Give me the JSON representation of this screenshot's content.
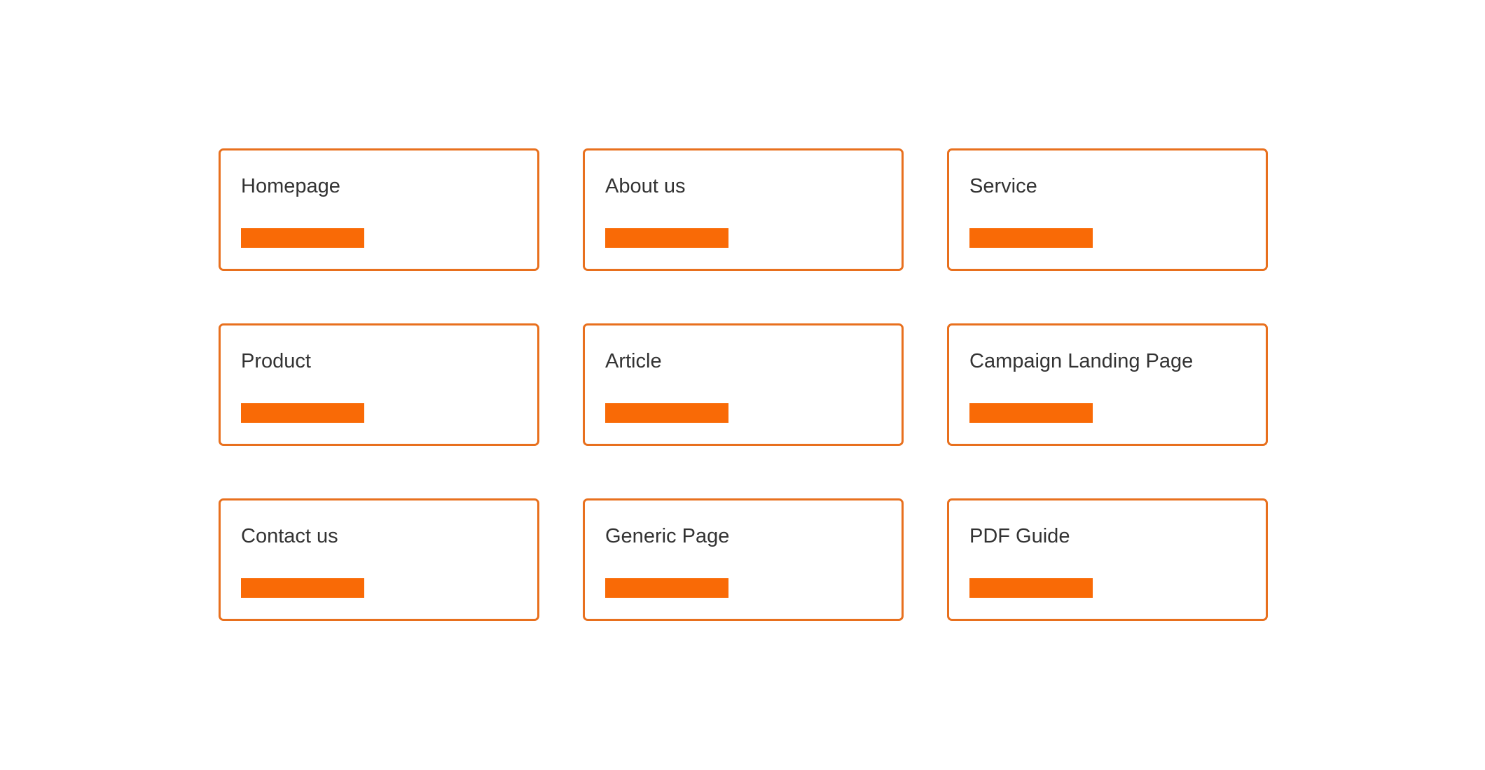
{
  "colors": {
    "card_border": "#E8701E",
    "accent_bar": "#F96A06",
    "text": "#333333",
    "background": "#FFFFFF"
  },
  "cards": [
    {
      "label": "Homepage"
    },
    {
      "label": "About us"
    },
    {
      "label": "Service"
    },
    {
      "label": "Product"
    },
    {
      "label": "Article"
    },
    {
      "label": "Campaign Landing Page"
    },
    {
      "label": "Contact us"
    },
    {
      "label": "Generic Page"
    },
    {
      "label": "PDF Guide"
    }
  ]
}
